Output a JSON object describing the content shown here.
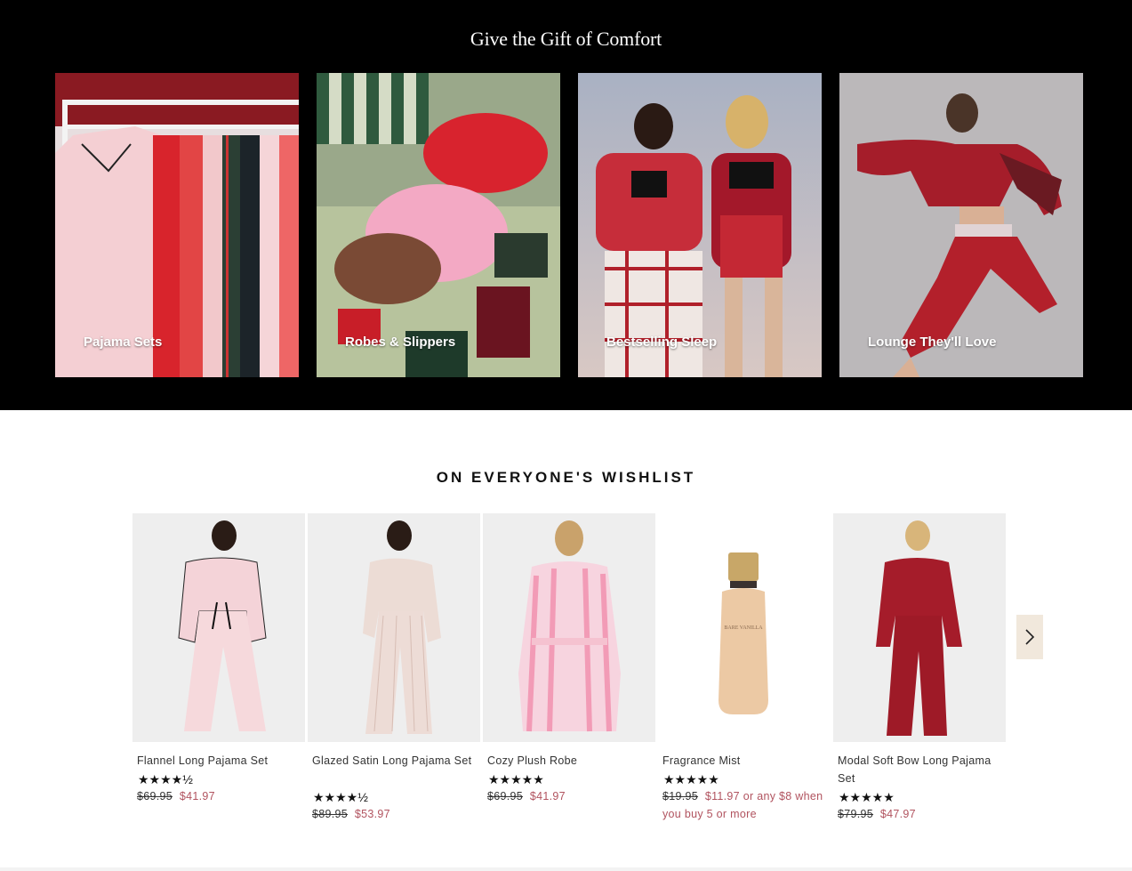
{
  "gift": {
    "title": "Give the Gift of Comfort",
    "tiles": [
      {
        "label": "Pajama Sets"
      },
      {
        "label": "Robes & Slippers"
      },
      {
        "label": "Bestselling Sleep"
      },
      {
        "label": "Lounge They'll Love"
      }
    ]
  },
  "wishlist": {
    "title": "ON EVERYONE'S WISHLIST",
    "products": [
      {
        "name": "Flannel Long Pajama Set",
        "stars": "★★★★½",
        "rating": 4.5,
        "old_price": "$69.95",
        "sale_price": "$41.97",
        "promo": ""
      },
      {
        "name": "Glazed Satin Long Pajama Set",
        "stars": "★★★★½",
        "rating": 4.5,
        "old_price": "$89.95",
        "sale_price": "$53.97",
        "promo": ""
      },
      {
        "name": "Cozy Plush Robe",
        "stars": "★★★★★",
        "rating": 5,
        "old_price": "$69.95",
        "sale_price": "$41.97",
        "promo": ""
      },
      {
        "name": "Fragrance Mist",
        "stars": "★★★★★",
        "rating": 5,
        "old_price": "$19.95",
        "sale_price": "$11.97 or any $8 when you buy 5 or more",
        "promo": ""
      },
      {
        "name": "Modal Soft Bow Long Pajama Set",
        "stars": "★★★★★",
        "rating": 5,
        "old_price": "$79.95",
        "sale_price": "$47.97",
        "promo": ""
      }
    ],
    "mist_bottle_label": "BARE VANILLA",
    "next_icon": "chevron-right-icon"
  },
  "colors": {
    "banner_bg": "#000000",
    "sale_price": "#b1535f",
    "next_button_bg": "#f1e8dc"
  }
}
